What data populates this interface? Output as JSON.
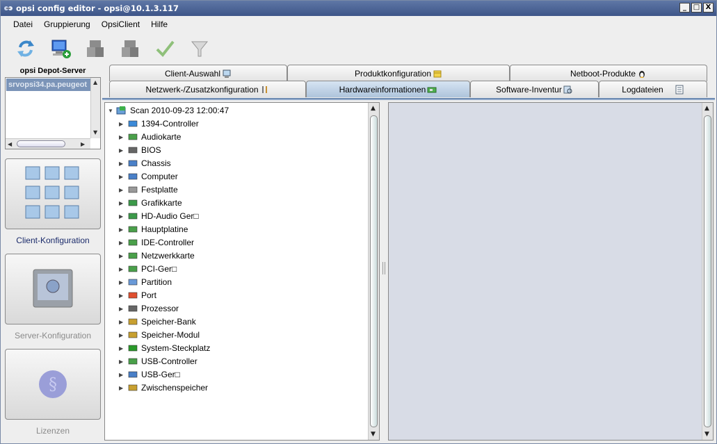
{
  "window": {
    "title": "opsi config editor - opsi@10.1.3.117"
  },
  "title_buttons": {
    "minimize": "_",
    "maximize": "□",
    "close": "X"
  },
  "menu": [
    "Datei",
    "Gruppierung",
    "OpsiClient",
    "Hilfe"
  ],
  "toolbar": [
    {
      "icon": "reload-icon"
    },
    {
      "icon": "add-client-icon"
    },
    {
      "icon": "server-disabled-icon"
    },
    {
      "icon": "server-disabled-icon-2"
    },
    {
      "icon": "checkmark-icon"
    },
    {
      "icon": "filter-icon"
    }
  ],
  "left": {
    "depot_label": "opsi Depot-Server",
    "depot_items": [
      "srvopsi34.pa.peugeot"
    ],
    "nav": [
      {
        "label": "Client-Konfiguration",
        "active": true
      },
      {
        "label": "Server-Konfiguration",
        "active": false
      },
      {
        "label": "Lizenzen",
        "active": false
      }
    ]
  },
  "tabs": {
    "row1": [
      "Client-Auswahl",
      "Produktkonfiguration",
      "Netboot-Produkte"
    ],
    "row2": [
      "Netzwerk-/Zusatzkonfiguration",
      "Hardwareinformationen",
      "Software-Inventur",
      "Logdateien"
    ],
    "active": "Hardwareinformationen"
  },
  "tree": {
    "root": "Scan 2010-09-23 12:00:47",
    "children": [
      "1394-Controller",
      "Audiokarte",
      "BIOS",
      "Chassis",
      "Computer",
      "Festplatte",
      "Grafikkarte",
      "HD-Audio Ger□",
      "Hauptplatine",
      "IDE-Controller",
      "Netzwerkkarte",
      "PCI-Ger□",
      "Partition",
      "Port",
      "Prozessor",
      "Speicher-Bank",
      "Speicher-Modul",
      "System-Steckplatz",
      "USB-Controller",
      "USB-Ger□",
      "Zwischenspeicher"
    ]
  },
  "colors": {
    "titlebar": "#4a629a",
    "active_tab": "#aec4dc",
    "selection": "#7b94b8",
    "detail_bg": "#d8dce6"
  }
}
